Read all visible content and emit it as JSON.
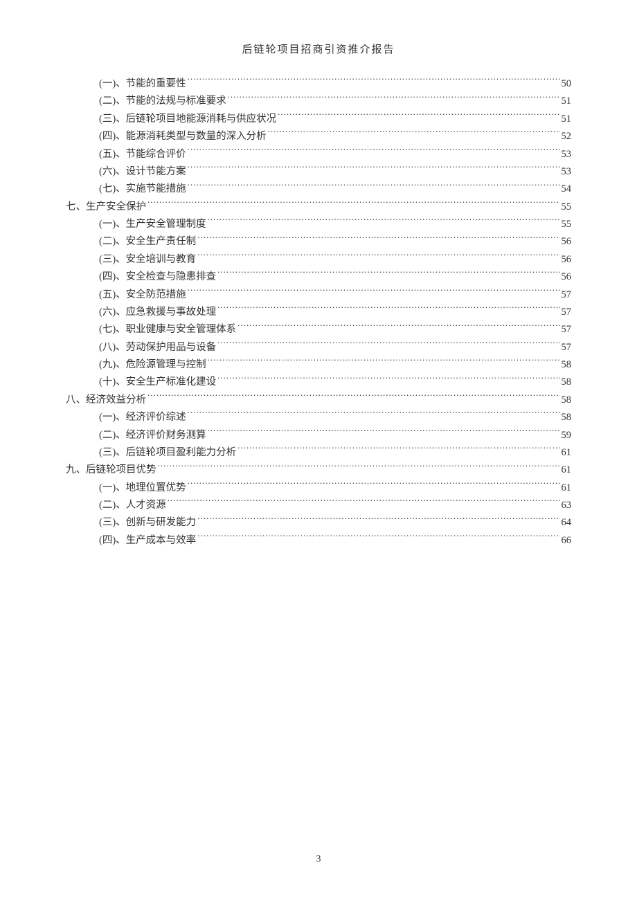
{
  "header_title": "后链轮项目招商引资推介报告",
  "page_number": "3",
  "toc": [
    {
      "level": 2,
      "label": "(一)、节能的重要性",
      "page": "50"
    },
    {
      "level": 2,
      "label": "(二)、节能的法规与标准要求",
      "page": "51"
    },
    {
      "level": 2,
      "label": "(三)、后链轮项目地能源消耗与供应状况",
      "page": "51"
    },
    {
      "level": 2,
      "label": "(四)、能源消耗类型与数量的深入分析",
      "page": "52"
    },
    {
      "level": 2,
      "label": "(五)、节能综合评价",
      "page": "53"
    },
    {
      "level": 2,
      "label": "(六)、设计节能方案",
      "page": "53"
    },
    {
      "level": 2,
      "label": "(七)、实施节能措施",
      "page": "54"
    },
    {
      "level": 1,
      "label": "七、生产安全保护",
      "page": "55"
    },
    {
      "level": 2,
      "label": "(一)、生产安全管理制度",
      "page": "55"
    },
    {
      "level": 2,
      "label": "(二)、安全生产责任制",
      "page": "56"
    },
    {
      "level": 2,
      "label": "(三)、安全培训与教育",
      "page": "56"
    },
    {
      "level": 2,
      "label": "(四)、安全检查与隐患排查",
      "page": "56"
    },
    {
      "level": 2,
      "label": "(五)、安全防范措施",
      "page": "57"
    },
    {
      "level": 2,
      "label": "(六)、应急救援与事故处理",
      "page": "57"
    },
    {
      "level": 2,
      "label": "(七)、职业健康与安全管理体系",
      "page": "57"
    },
    {
      "level": 2,
      "label": "(八)、劳动保护用品与设备",
      "page": "57"
    },
    {
      "level": 2,
      "label": "(九)、危险源管理与控制",
      "page": "58"
    },
    {
      "level": 2,
      "label": "(十)、安全生产标准化建设",
      "page": "58"
    },
    {
      "level": 1,
      "label": "八、经济效益分析",
      "page": "58"
    },
    {
      "level": 2,
      "label": "(一)、经济评价综述",
      "page": "58"
    },
    {
      "level": 2,
      "label": "(二)、经济评价财务测算",
      "page": "59"
    },
    {
      "level": 2,
      "label": "(三)、后链轮项目盈利能力分析",
      "page": "61"
    },
    {
      "level": 1,
      "label": "九、后链轮项目优势",
      "page": "61"
    },
    {
      "level": 2,
      "label": "(一)、地理位置优势",
      "page": "61"
    },
    {
      "level": 2,
      "label": "(二)、人才资源",
      "page": "63"
    },
    {
      "level": 2,
      "label": "(三)、创新与研发能力",
      "page": "64"
    },
    {
      "level": 2,
      "label": "(四)、生产成本与效率",
      "page": "66"
    }
  ]
}
